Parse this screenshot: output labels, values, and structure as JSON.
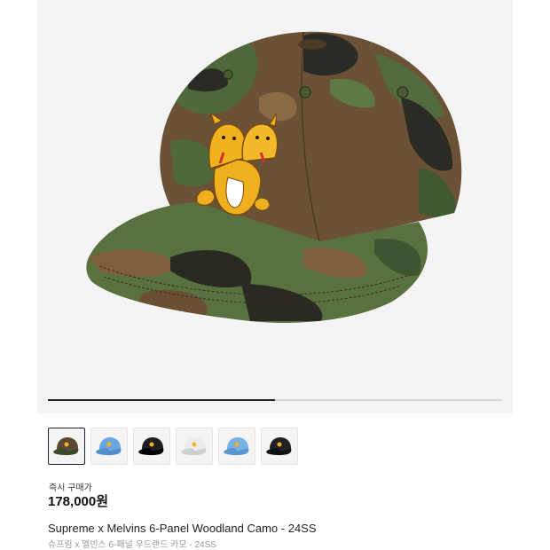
{
  "product": {
    "buy_label": "즉시 구매가",
    "price": "178,000원",
    "name": "Supreme x Melvins 6-Panel Woodland Camo - 24SS",
    "name_ko": "슈프림 x 멜빈스 6-패널 우드랜드 카모 - 24SS"
  },
  "gallery": {
    "progress": 0.5,
    "selected_index": 0,
    "thumbnails": [
      {
        "colorway": "woodland-camo",
        "crown": "#5b4a33",
        "accent": "#3c4a2a"
      },
      {
        "colorway": "light-blue",
        "crown": "#6aa6df",
        "accent": "#4f8fcc"
      },
      {
        "colorway": "black",
        "crown": "#1e1e1e",
        "accent": "#000000"
      },
      {
        "colorway": "white",
        "crown": "#ececec",
        "accent": "#cfcfcf"
      },
      {
        "colorway": "light-blue",
        "crown": "#7ab1e3",
        "accent": "#5a97d2"
      },
      {
        "colorway": "black",
        "crown": "#222222",
        "accent": "#111111"
      }
    ]
  },
  "colors": {
    "hero_bg": "#f4f4f4",
    "embroidery": "#f0b31e"
  }
}
